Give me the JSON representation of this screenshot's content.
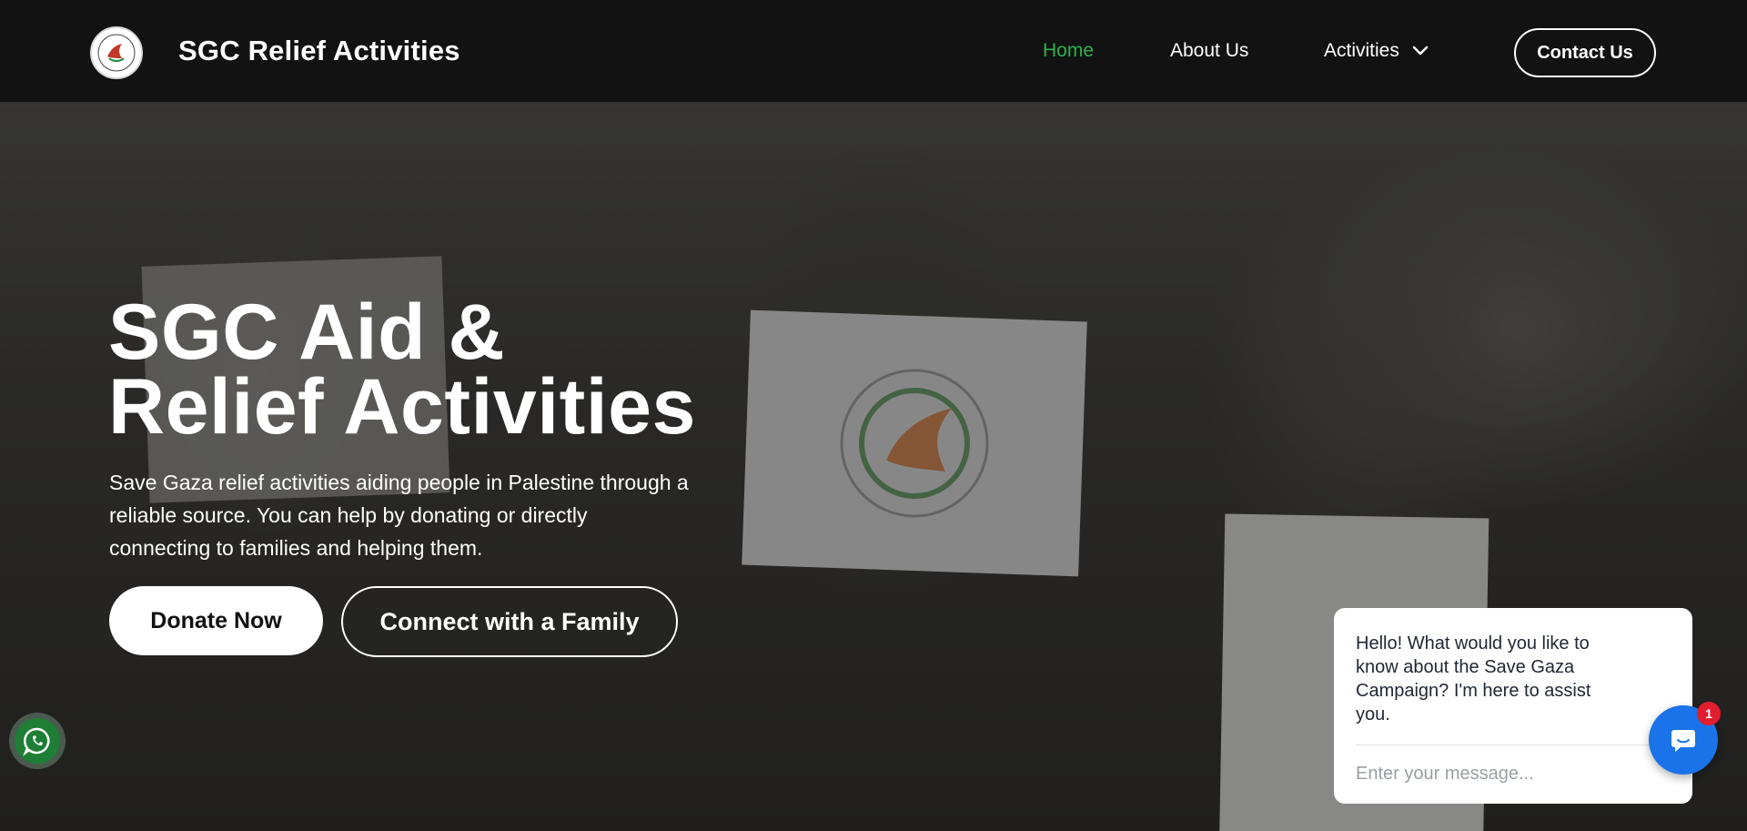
{
  "header": {
    "brand": "SGC Relief Activities",
    "logo_icon": "save-gaza-campaign-logo",
    "nav": {
      "home": "Home",
      "about": "About Us",
      "activities": "Activities"
    },
    "contact_label": "Contact Us",
    "active_color": "#2bb24c"
  },
  "hero": {
    "title_line1": "SGC Aid &",
    "title_line2": "Relief Activities",
    "description": "Save Gaza relief activities aiding people in Palestine through a reliable source. You can help by donating or directly connecting to families and helping them.",
    "donate_label": "Donate Now",
    "connect_label": "Connect with a Family"
  },
  "chat": {
    "greeting": "Hello! What would you like to know about the Save Gaza Campaign? I'm here to assist you.",
    "placeholder": "Enter your message...",
    "badge_count": "1",
    "launcher_color": "#1a73e8"
  },
  "whatsapp": {
    "icon": "whatsapp-icon",
    "color": "#25d366"
  }
}
